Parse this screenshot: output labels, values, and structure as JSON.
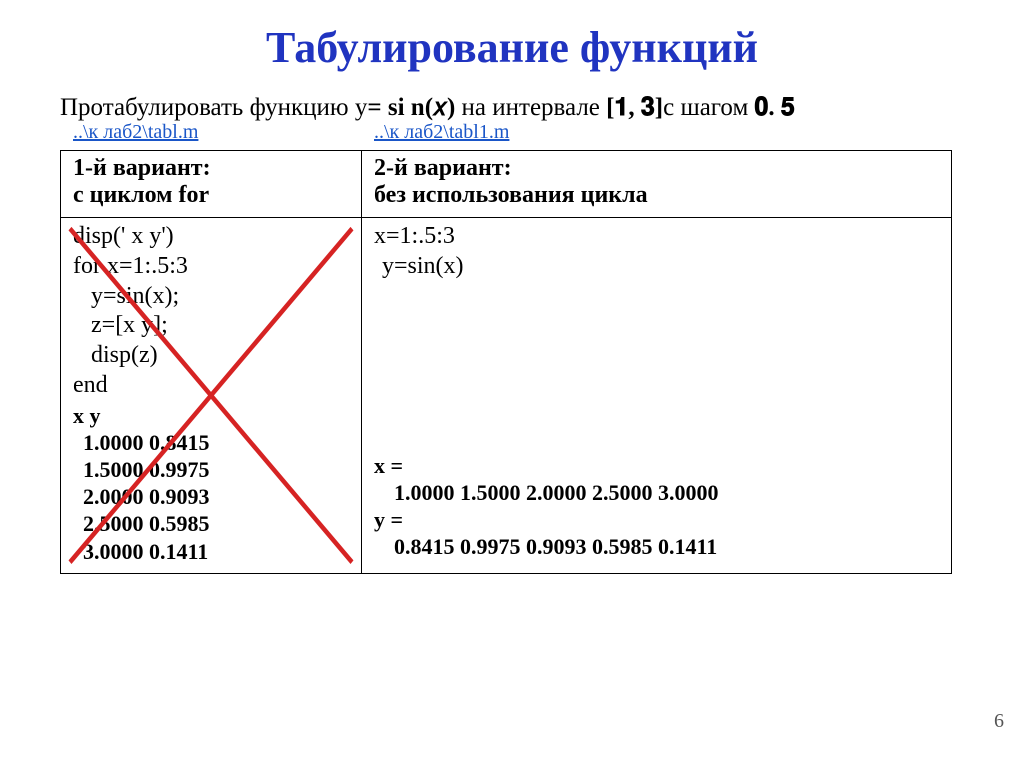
{
  "title": "Табулирование функций",
  "task_prefix": "Протабулировать функцию  y",
  "task_eq": "= si n(𝑥)",
  "task_mid": " на интервале ",
  "task_interval": "[𝟏, 𝟑]",
  "task_step_prefix": "с шагом ",
  "task_step": "𝟎. 𝟓",
  "link1": "..\\к лаб2\\tabl.m",
  "link2": "..\\к лаб2\\tabl1.m",
  "variant1_t1": "1-й вариант:",
  "variant1_t2": "с циклом for",
  "variant2_t1": "2-й вариант:",
  "variant2_t2": "без использования цикла",
  "code1": {
    "l1": "disp('      x           y')",
    "l2": "for x=1:.5:3",
    "l3": "y=sin(x);",
    "l4": "z=[x y];",
    "l5": "disp(z)",
    "l6": "end"
  },
  "out1": {
    "hdr": "x         y",
    "r1": "1.0000    0.8415",
    "r2": "1.5000    0.9975",
    "r3": "2.0000    0.9093",
    "r4": "2.5000    0.5985",
    "r5": "3.0000    0.1411"
  },
  "code2": {
    "l1": "x=1:.5:3",
    "l2": "y=sin(x)"
  },
  "out2": {
    "xh": "x =",
    "xr": "1.0000    1.5000    2.0000    2.5000    3.0000",
    "yh": "y =",
    "yr": "0.8415    0.9975    0.9093    0.5985    0.1411"
  },
  "pagenum": "6",
  "chart_data": {
    "type": "table",
    "title": "Табулирование y = sin(x) на [1,3] с шагом 0.5",
    "series": [
      {
        "name": "x",
        "values": [
          1.0,
          1.5,
          2.0,
          2.5,
          3.0
        ]
      },
      {
        "name": "y",
        "values": [
          0.8415,
          0.9975,
          0.9093,
          0.5985,
          0.1411
        ]
      }
    ]
  }
}
